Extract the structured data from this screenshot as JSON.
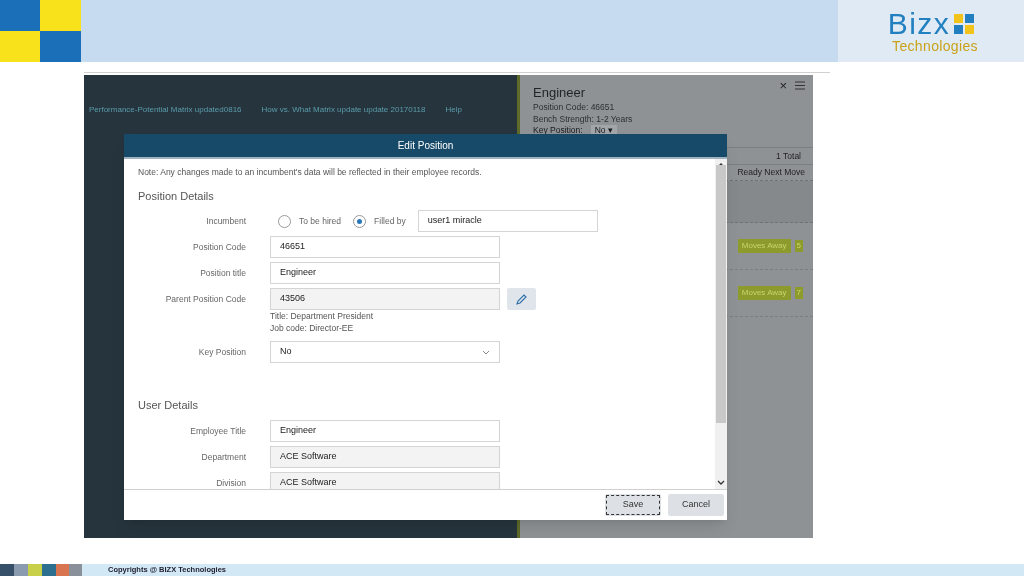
{
  "slide": {
    "logo": {
      "name": "Bizx",
      "tagline": "Technologies"
    },
    "footer": "Copyrights @ BIZX Technologies"
  },
  "app": {
    "nav_links": [
      "Performance-Potential Matrix updated0816",
      "How vs. What Matrix update update 20170118",
      "Help"
    ],
    "side_panel": {
      "close": "×",
      "title": "Engineer",
      "lines": [
        "Position Code: 46651",
        "Bench Strength: 1-2 Years"
      ],
      "key_position_label": "Key Position:",
      "key_position_value": "No ▾",
      "total": "1 Total",
      "column": "Ready Next Move",
      "rows": [
        {
          "tag": "Moves Away",
          "count": "5"
        },
        {
          "tag": "Moves Away",
          "count": "7"
        }
      ]
    }
  },
  "dialog": {
    "title": "Edit Position",
    "note": "Note: Any changes made to an incumbent's data will be reflected in their employee records.",
    "sections": [
      {
        "heading": "Position Details",
        "fields": [
          {
            "kind": "radio",
            "label": "Incumbent",
            "options": [
              {
                "label": "To be hired",
                "selected": false
              },
              {
                "label": "Filled by",
                "selected": true
              }
            ],
            "value": "user1 miracle"
          },
          {
            "kind": "text",
            "label": "Position Code",
            "value": "46651"
          },
          {
            "kind": "text",
            "label": "Position title",
            "value": "Engineer"
          },
          {
            "kind": "readonly",
            "label": "Parent Position Code",
            "value": "43506",
            "editable": true,
            "info": [
              "Title: Department President",
              "Job code: Director-EE"
            ]
          },
          {
            "kind": "select",
            "label": "Key Position",
            "value": "No"
          }
        ]
      },
      {
        "heading": "User Details",
        "fields": [
          {
            "kind": "text",
            "label": "Employee Title",
            "value": "Engineer"
          },
          {
            "kind": "readonly",
            "label": "Department",
            "value": "ACE Software"
          },
          {
            "kind": "readonly",
            "label": "Division",
            "value": "ACE Software"
          }
        ]
      }
    ],
    "buttons": [
      {
        "label": "Save",
        "focused": true
      },
      {
        "label": "Cancel",
        "focused": false
      }
    ]
  }
}
